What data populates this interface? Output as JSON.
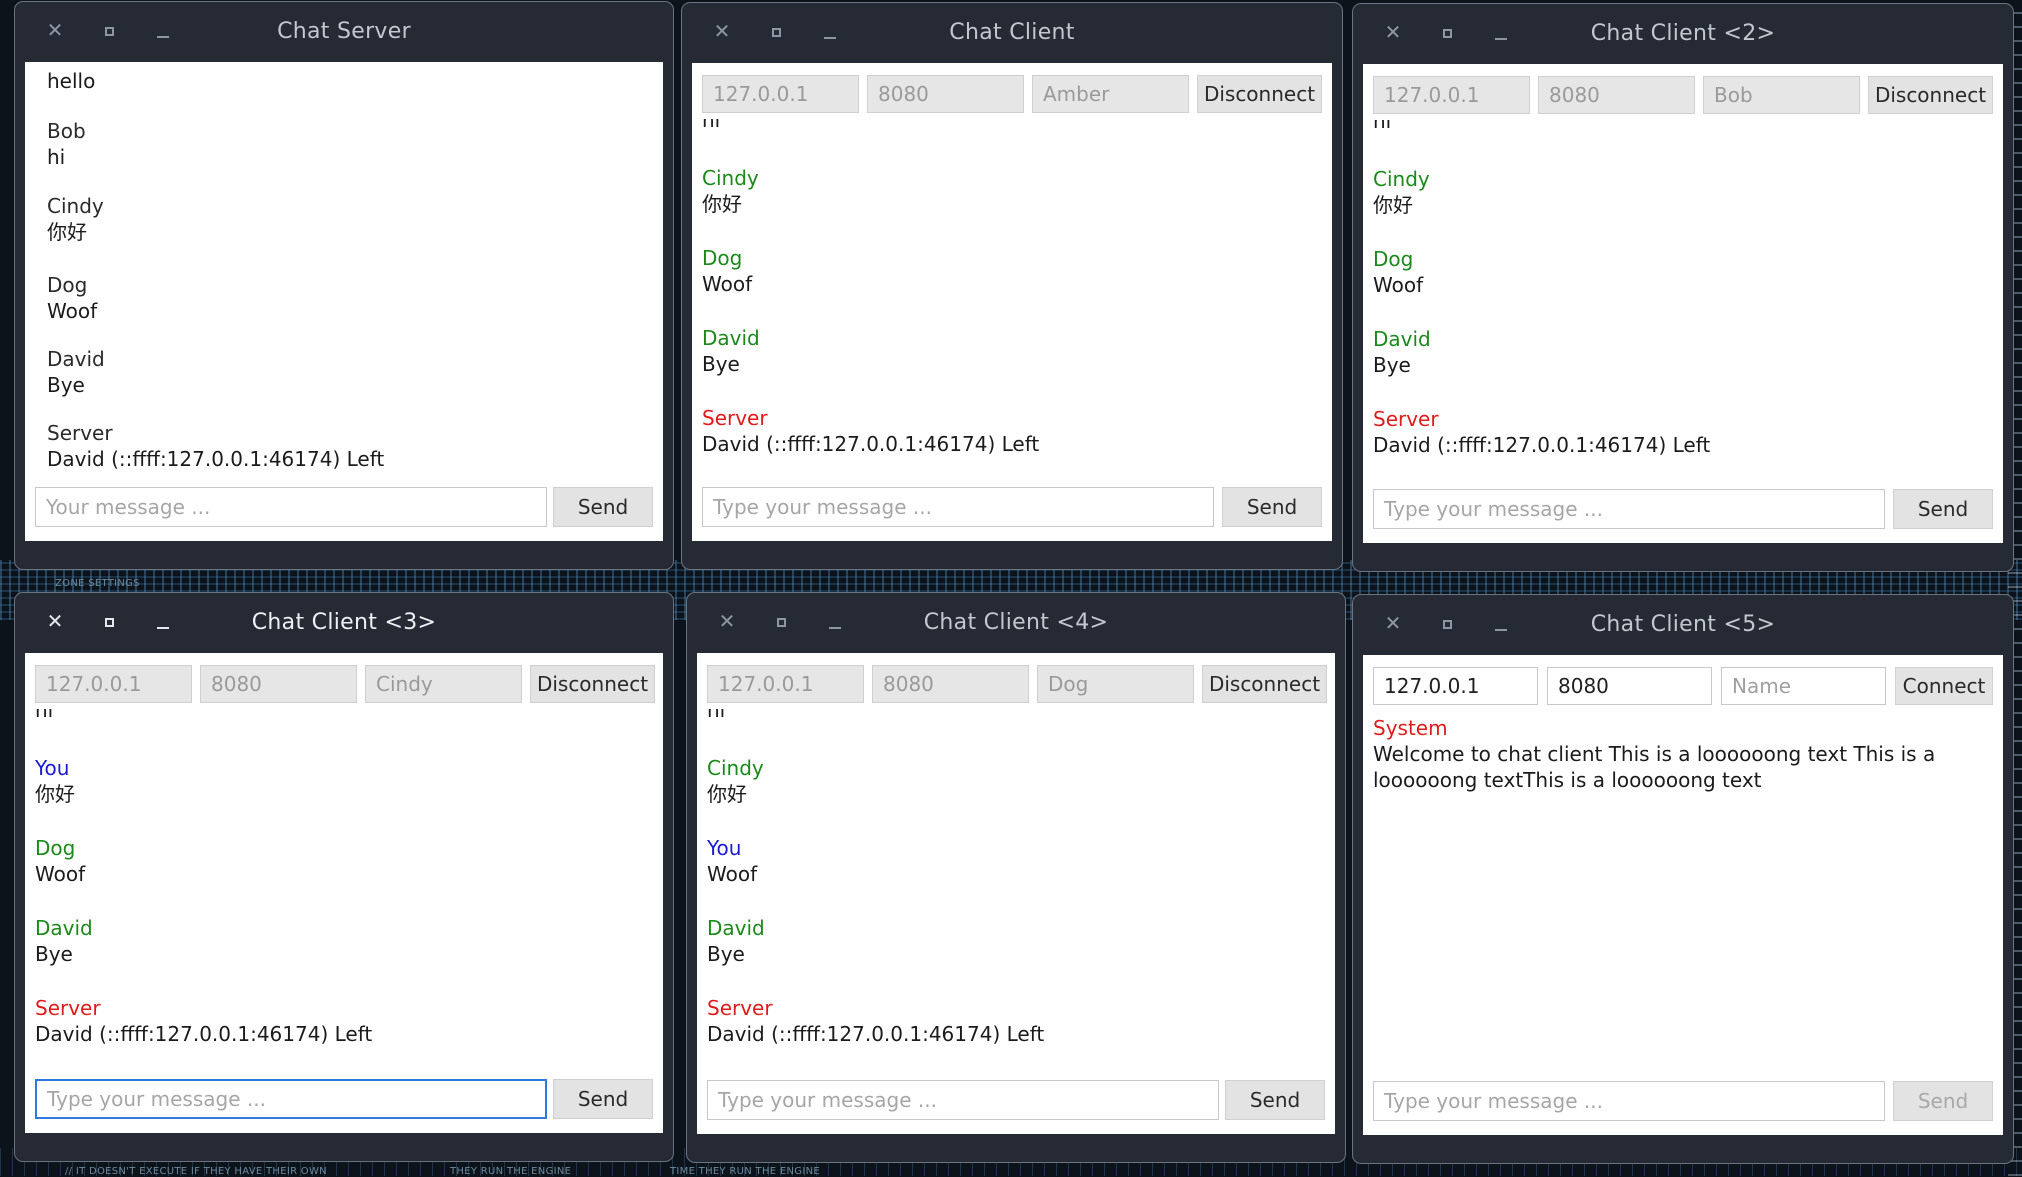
{
  "background": {
    "captions": [
      "ZONE SETTINGS",
      "// IT DOESN'T EXECUTE IF THEY HAVE THEIR OWN",
      "THEY RUN THE ENGINE",
      "TIME THEY RUN THE ENGINE"
    ]
  },
  "server": {
    "title": "Chat Server",
    "messages": [
      {
        "sender": "",
        "text": "hello"
      },
      {
        "sender": "Bob",
        "text": "hi"
      },
      {
        "sender": "Cindy",
        "text": "你好"
      },
      {
        "sender": "Dog",
        "text": "Woof"
      },
      {
        "sender": "David",
        "text": "Bye"
      },
      {
        "sender": "Server",
        "text": "David (::ffff:127.0.0.1:46174) Left"
      }
    ],
    "input_placeholder": "Your message ...",
    "send_label": "Send"
  },
  "client1": {
    "title": "Chat Client",
    "host": "127.0.0.1",
    "port": "8080",
    "name": "Amber",
    "button_label": "Disconnect",
    "cut_text": "hi",
    "messages": [
      {
        "sender": "Cindy",
        "text": "你好"
      },
      {
        "sender": "Dog",
        "text": "Woof"
      },
      {
        "sender": "David",
        "text": "Bye"
      },
      {
        "sender": "Server",
        "text": "David (::ffff:127.0.0.1:46174) Left"
      }
    ],
    "input_placeholder": "Type your message ...",
    "send_label": "Send"
  },
  "client2": {
    "title": "Chat Client <2>",
    "host": "127.0.0.1",
    "port": "8080",
    "name": "Bob",
    "button_label": "Disconnect",
    "cut_text": "hi",
    "messages": [
      {
        "sender": "Cindy",
        "text": "你好"
      },
      {
        "sender": "Dog",
        "text": "Woof"
      },
      {
        "sender": "David",
        "text": "Bye"
      },
      {
        "sender": "Server",
        "text": "David (::ffff:127.0.0.1:46174) Left"
      }
    ],
    "input_placeholder": "Type your message ...",
    "send_label": "Send"
  },
  "client3": {
    "title": "Chat Client <3>",
    "host": "127.0.0.1",
    "port": "8080",
    "name": "Cindy",
    "button_label": "Disconnect",
    "cut_text": "hi",
    "messages": [
      {
        "sender": "You",
        "text": "你好"
      },
      {
        "sender": "Dog",
        "text": "Woof"
      },
      {
        "sender": "David",
        "text": "Bye"
      },
      {
        "sender": "Server",
        "text": "David (::ffff:127.0.0.1:46174) Left"
      }
    ],
    "input_placeholder": "Type your message ...",
    "send_label": "Send"
  },
  "client4": {
    "title": "Chat Client <4>",
    "host": "127.0.0.1",
    "port": "8080",
    "name": "Dog",
    "button_label": "Disconnect",
    "cut_text": "hi",
    "messages": [
      {
        "sender": "Cindy",
        "text": "你好"
      },
      {
        "sender": "You",
        "text": "Woof"
      },
      {
        "sender": "David",
        "text": "Bye"
      },
      {
        "sender": "Server",
        "text": "David (::ffff:127.0.0.1:46174) Left"
      }
    ],
    "input_placeholder": "Type your message ...",
    "send_label": "Send"
  },
  "client5": {
    "title": "Chat Client <5>",
    "host": "127.0.0.1",
    "port": "8080",
    "name_placeholder": "Name",
    "button_label": "Connect",
    "system_sender": "System",
    "system_line1": "Welcome to chat client This is a loooooong text This is a",
    "system_line2": "loooooong textThis is a loooooong text",
    "input_placeholder": "Type your message ...",
    "send_label": "Send"
  },
  "colors": {
    "window_bg": "#252a34",
    "other_user": "#1b8a1b",
    "server": "#e01b1b",
    "you": "#1a1ad0",
    "focus_border": "#2a7ae0"
  }
}
